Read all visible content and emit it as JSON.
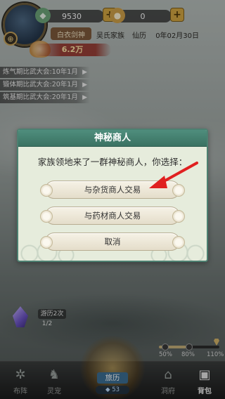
{
  "header": {
    "avatar_badge": "⊕",
    "resource_a": {
      "icon": "jade-icon",
      "value": "9530",
      "add": "+"
    },
    "resource_b": {
      "icon": "gold-icon",
      "value": "0",
      "add": "+"
    },
    "player_name": "白衣剑神",
    "clan_name": "吴氏家族",
    "xianli_label": "仙历",
    "date_text": "0年02月30日",
    "power": "6.2万"
  },
  "notices": [
    "炼气期比武大会:10年1月",
    "锻体期比武大会:20年1月",
    "筑基期比武大会:20年1月"
  ],
  "dialog": {
    "title": "神秘商人",
    "message": "家族领地来了一群神秘商人，你选择：",
    "options": [
      "与杂货商人交易",
      "与药材商人交易",
      "取消"
    ]
  },
  "travel": {
    "label": "游历2次",
    "count": "1/2"
  },
  "progress": {
    "left_label": "50%",
    "mid_label": "80%",
    "right_label": "110%",
    "value": 0.45,
    "accent": "#c6b07a"
  },
  "explore": {
    "label": "旅历",
    "count": "53"
  },
  "nav": [
    {
      "label": "布阵",
      "icon": "formation-icon"
    },
    {
      "label": "灵宠",
      "icon": "pet-icon"
    },
    {
      "label": "洞府",
      "icon": "cave-icon"
    },
    {
      "label": "背包",
      "icon": "bag-icon"
    }
  ],
  "colors": {
    "dialog_header": "#3a7262",
    "arrow": "#e02020"
  }
}
